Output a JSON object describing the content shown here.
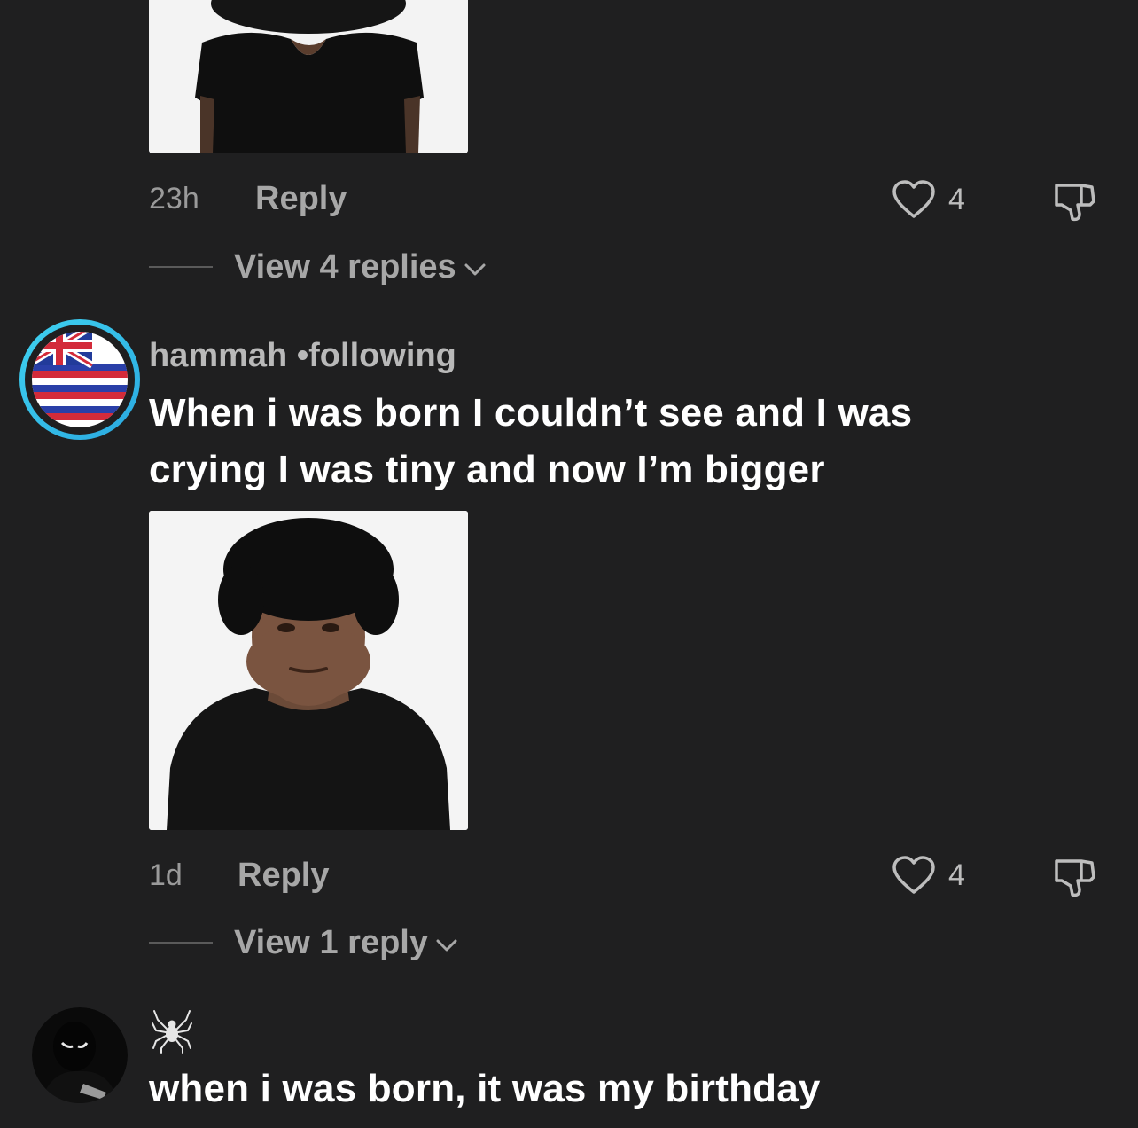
{
  "comments": [
    {
      "time": "23h",
      "reply_label": "Reply",
      "likes": "4",
      "view_replies": "View 4 replies"
    },
    {
      "username": "hammah",
      "badge": " •following",
      "text_line1": "When i was born I couldn’t see and I was",
      "text_line2": "crying I was tiny and now I’m bigger",
      "time": "1d",
      "reply_label": "Reply",
      "likes": "4",
      "view_replies": "View 1 reply"
    },
    {
      "text": "when i was born, it was my birthday"
    }
  ],
  "colors": {
    "background": "#1f1f20",
    "secondary_text": "#a7a7a7",
    "avatar_ring_start": "#3fd2f0",
    "avatar_ring_end": "#2aa8e0"
  },
  "icons": [
    "heart-icon",
    "dislike-icon",
    "chevron-down-icon",
    "spider-icon"
  ]
}
